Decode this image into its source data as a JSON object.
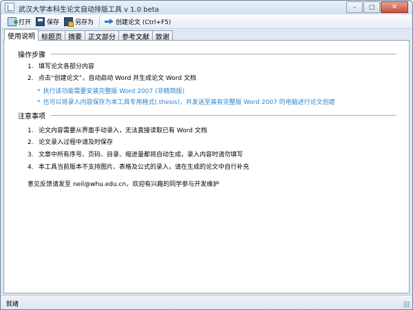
{
  "window": {
    "title": "武汉大学本科生论文自动排版工具 v 1.0 beta",
    "controls": {
      "minimize": "–",
      "maximize": "□",
      "close": "✕"
    }
  },
  "toolbar": {
    "open_label": "打开",
    "save_label": "保存",
    "save_as_label": "另存为",
    "create_label": "创建论文 (Ctrl+F5)"
  },
  "tabs": [
    "使用说明",
    "标题页",
    "摘要",
    "正文部分",
    "参考文献",
    "致谢"
  ],
  "active_tab": "使用说明",
  "instructions": {
    "steps_title": "操作步骤",
    "steps": [
      {
        "num": "1.",
        "text": "填写论文各部分内容"
      },
      {
        "num": "2.",
        "text": "点击“创建论文”，自动启动 Word 并生成论文 Word 文档"
      }
    ],
    "step_notes": [
      "执行该功能需要安装完整版 Word 2007 (非精简版)",
      "也可以将录入内容保存为本工具专用格式(.thesis)，并发送至装有完整版 Word 2007 的电脑进行论文创建"
    ],
    "notes_title": "注意事项",
    "notes": [
      {
        "num": "1.",
        "text": "论文内容需要从界面手动录入，无法直接读取已有 Word 文档"
      },
      {
        "num": "2.",
        "text": "论文录入过程中请及时保存"
      },
      {
        "num": "3.",
        "text": "文章中所有序号、页码、目录、缩进量都将自动生成，录入内容时请勿填写"
      },
      {
        "num": "4.",
        "text": "本工具当前版本不支持图片、表格及公式的录入，请在生成的论文中自行补充"
      }
    ],
    "feedback": "意见反馈请发至 neil@whu.edu.cn，欢迎有兴趣的同学参与开发维护"
  },
  "status": {
    "text": "就绪"
  },
  "colors": {
    "note_text": "#2f83c8",
    "window_frame": "#dfe8f2",
    "close_button": "#c9503b"
  }
}
